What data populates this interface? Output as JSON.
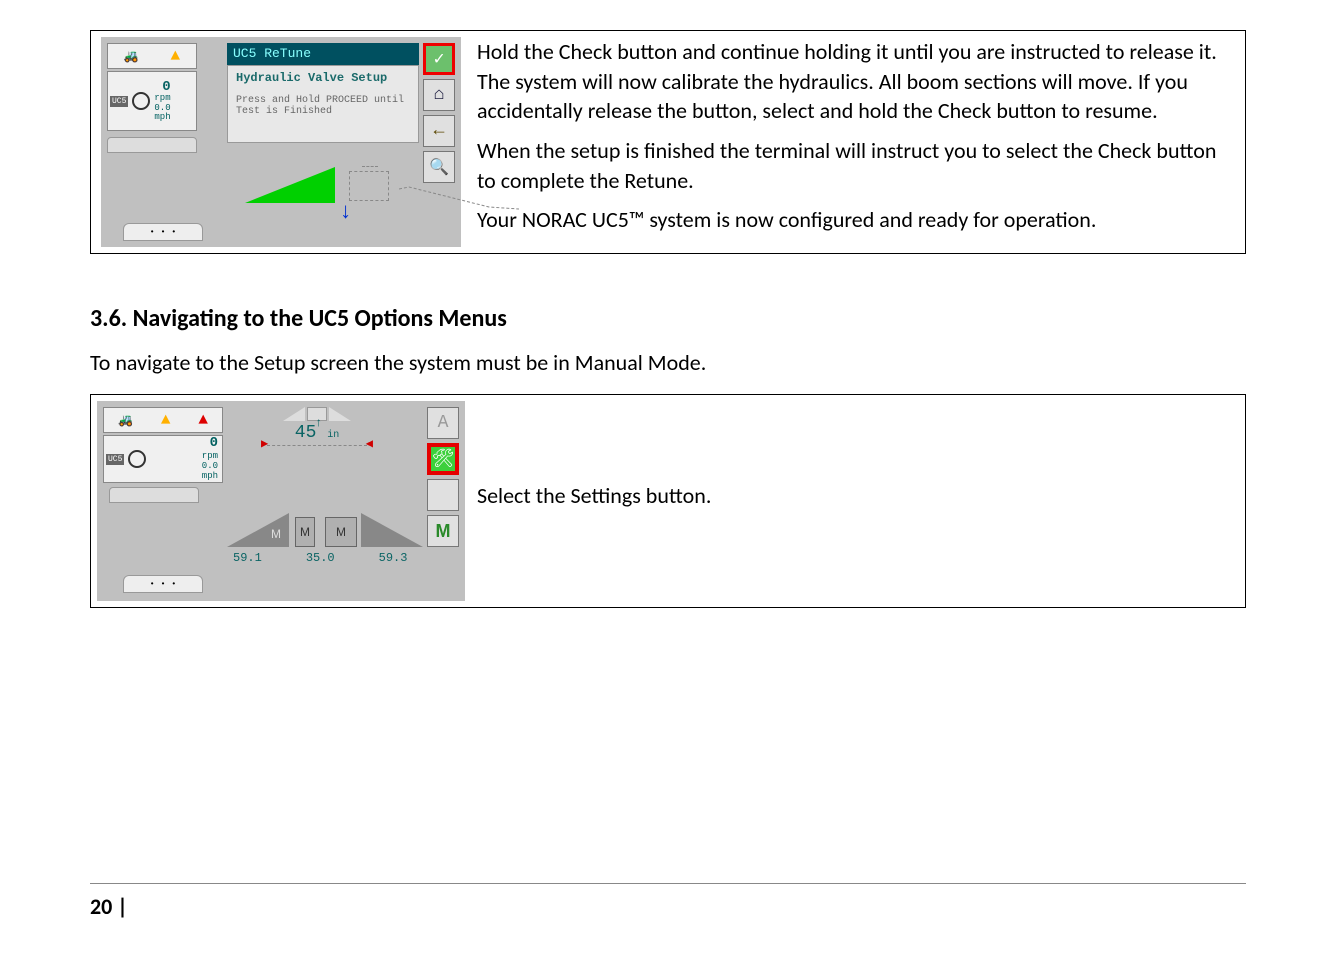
{
  "row1": {
    "screenshot": {
      "title": "UC5 ReTune",
      "panel_heading": "Hydraulic Valve Setup",
      "panel_sub": "Press and Hold PROCEED until Test is Finished",
      "readings": {
        "big": "0",
        "rpm_label": "rpm",
        "speed": "0.0",
        "speed_unit": "mph"
      },
      "buttons": {
        "check": "✓",
        "home": "⌂",
        "back": "←",
        "zoom": "🔍"
      }
    },
    "para1": "Hold the Check button and continue holding it until you are instructed to release it.  The system will now calibrate the hydraulics.  All boom sections will move.  If you accidentally release the button, select and hold the Check button to resume.",
    "para2": "When the setup is finished the terminal will instruct you to select the Check button to complete the Retune.",
    "para3": "Your NORAC UC5™ system is now configured and ready for operation."
  },
  "section_heading": "3.6.  Navigating to the UC5 Options Menus",
  "section_intro": "To navigate to the Setup screen the system must be in Manual Mode.",
  "row2": {
    "screenshot": {
      "height_value": "45",
      "height_unit": "in",
      "mode_labels": [
        "M",
        "M",
        "M"
      ],
      "vals": [
        "59.1",
        "35.0",
        "59.3"
      ],
      "readings": {
        "big": "0",
        "rpm_label": "rpm",
        "speed": "0.0",
        "speed_unit": "mph"
      },
      "mode_btn": "M",
      "wrench": "🛠",
      "auto": "A"
    },
    "text": "Select the Settings button."
  },
  "page_number": "20 |"
}
